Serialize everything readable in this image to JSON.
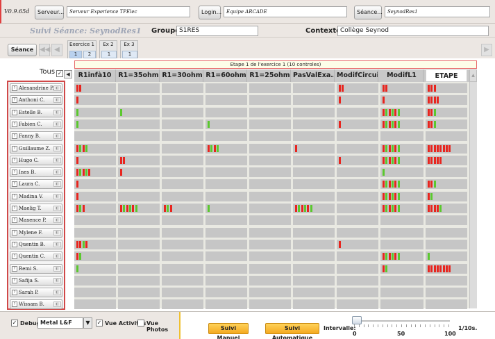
{
  "top": {
    "version": "V0.9.65d",
    "server_button": "Serveur...",
    "server_field": "Serveur Experience TPElec",
    "login_button": "Login...",
    "login_field": "Equipe ARCADE",
    "seance_button": "Séance...",
    "seance_field": "SeynodRes1"
  },
  "title_row": {
    "title": "Suivi Séance: SeynodRes1",
    "groupe_label": "Groupe",
    "groupe_value": "S1RES",
    "contexte_label": "Contexte",
    "contexte_value": "Collège Seynod"
  },
  "nav": {
    "seance_label": "Séance",
    "exercises": [
      {
        "label": "Exercice 1",
        "subs": [
          "1",
          "2"
        ]
      },
      {
        "label": "Ex 2",
        "subs": [
          "1"
        ]
      },
      {
        "label": "Ex 3",
        "subs": [
          "1"
        ]
      }
    ]
  },
  "grid": {
    "banner": "Etape 1 de l'exercice 1 (10 controles)",
    "tous_label": "Tous",
    "columns": [
      "R1infà10",
      "R1=35ohm",
      "R1=30ohm",
      "R1=60ohm",
      "R1=25ohm",
      "PasValExa...",
      "ModifCircui...",
      "ModifL1",
      "ETAPE"
    ],
    "students": [
      "Alexandrine P.",
      "Anthoni C.",
      "Estelle B.",
      "Fabien C.",
      "Fanny B.",
      "Guillaume Z.",
      "Hugo C.",
      "Ines B.",
      "Laura C.",
      "Madina V.",
      "Maelig T.",
      "Maxence P.",
      "Mylene F.",
      "Quentin B.",
      "Quentin C.",
      "Remi S.",
      "Safija S.",
      "Sarah P.",
      "Wissam B."
    ],
    "marks": [
      [
        "RR",
        "",
        "",
        "",
        "",
        "",
        "RR",
        "RR",
        "RRR"
      ],
      [
        "R",
        "",
        "",
        "",
        "",
        "",
        "R",
        "R",
        "RRRR"
      ],
      [
        "G",
        "G",
        "",
        "",
        "",
        "",
        "",
        "RGRGRG",
        "RRG"
      ],
      [
        "G",
        "",
        "",
        "G",
        "",
        "",
        "R",
        "RGRGRG",
        "RRG"
      ],
      [
        "",
        "",
        "",
        "",
        "",
        "",
        "",
        "",
        ""
      ],
      [
        "RGRG",
        "",
        "",
        "RGRG",
        "",
        "R",
        "",
        "RGRGRG",
        "RRRRRRRR"
      ],
      [
        "R",
        "RR",
        "",
        "",
        "",
        "",
        "R",
        "RGRGRG",
        "RRRRR"
      ],
      [
        "RGRGR",
        "R",
        "",
        "",
        "",
        "",
        "",
        "G",
        ""
      ],
      [
        "R",
        "",
        "",
        "",
        "",
        "",
        "",
        "RGRGRG",
        "RRG"
      ],
      [
        "R",
        "",
        "",
        "",
        "",
        "",
        "",
        "RGRGRG",
        "RG"
      ],
      [
        "RGR",
        "RGRGRG",
        "RGR",
        "G",
        "",
        "RGRGRG",
        "",
        "RGRGRG",
        "RRRRG"
      ],
      [
        "",
        "",
        "",
        "",
        "",
        "",
        "",
        "",
        ""
      ],
      [
        "",
        "",
        "",
        "",
        "",
        "",
        "",
        "",
        ""
      ],
      [
        "RRGR",
        "",
        "",
        "",
        "",
        "",
        "R",
        "",
        ""
      ],
      [
        "RG",
        "",
        "",
        "",
        "",
        "",
        "",
        "RGRGRG",
        "G"
      ],
      [
        "G",
        "",
        "",
        "",
        "",
        "",
        "",
        "RG",
        "RRRRRRRR"
      ],
      [
        "",
        "",
        "",
        "",
        "",
        "",
        "",
        "",
        ""
      ],
      [
        "",
        "",
        "",
        "",
        "",
        "",
        "",
        "",
        ""
      ],
      [
        "",
        "",
        "",
        "",
        "",
        "",
        "",
        "",
        ""
      ]
    ]
  },
  "bottom": {
    "debug_label": "Debug",
    "laf_value": "Metal L&F",
    "vue_activites_label": "Vue Activités",
    "vue_photos_label": "Vue Photos",
    "suivi_manuel": "Suivi Manuel",
    "suivi_auto": "Suivi Automatique",
    "intervalle_label": "Intervalle:",
    "unit_label": "1/10s.",
    "tick_labels": [
      "0",
      "50",
      "100"
    ],
    "slider_value": 3
  },
  "colors": {
    "red": "#e8251e",
    "green": "#5bc82e",
    "accent_yellow": "#f4a820"
  }
}
